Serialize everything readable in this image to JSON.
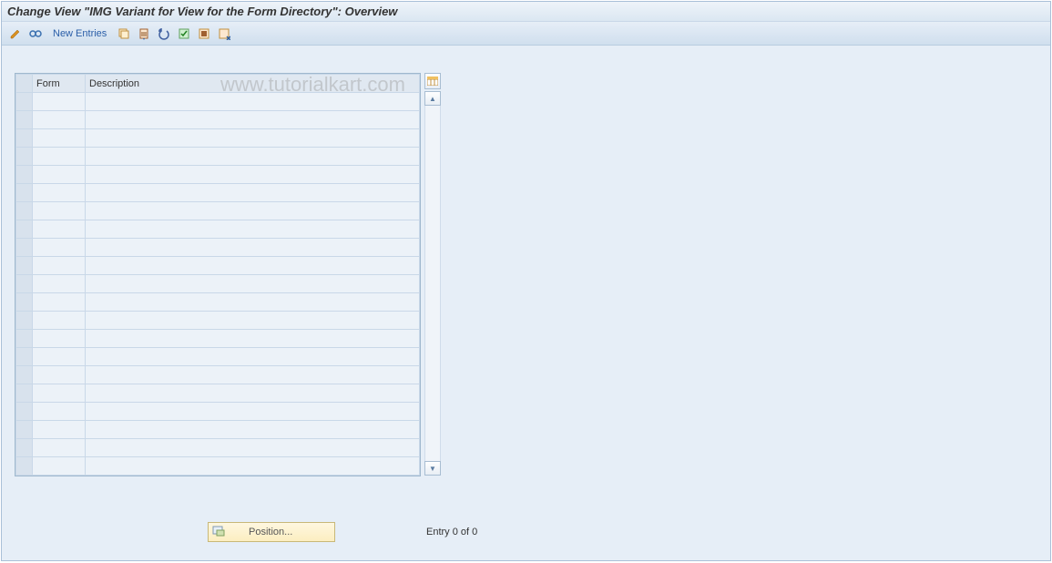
{
  "title": "Change View \"IMG Variant for View for the Form Directory\": Overview",
  "toolbar": {
    "new_entries_label": "New Entries"
  },
  "watermark": "www.tutorialkart.com",
  "table": {
    "columns": {
      "form": "Form",
      "description": "Description"
    },
    "row_count": 21
  },
  "footer": {
    "position_label": "Position...",
    "entry_text": "Entry 0 of 0"
  }
}
